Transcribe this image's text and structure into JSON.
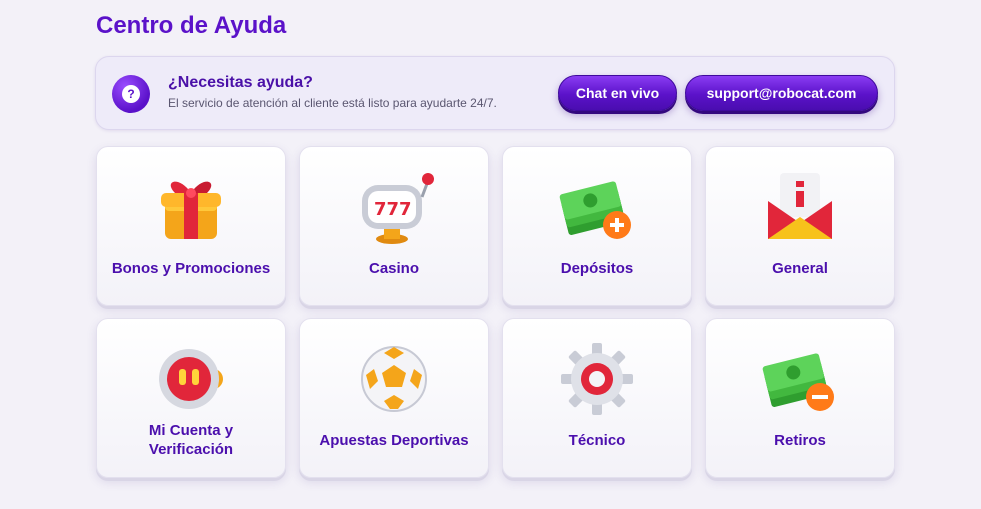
{
  "page": {
    "title": "Centro de Ayuda"
  },
  "help": {
    "title": "¿Necesitas ayuda?",
    "subtitle": "El servicio de atención al cliente está listo para ayudarte 24/7.",
    "icon": "question-icon",
    "chat_label": "Chat en vivo",
    "email_label": "support@robocat.com"
  },
  "categories": [
    {
      "label": "Bonos y Promociones",
      "icon": "gift-icon"
    },
    {
      "label": "Casino",
      "icon": "slot-machine-icon"
    },
    {
      "label": "Depósitos",
      "icon": "money-plus-icon"
    },
    {
      "label": "General",
      "icon": "info-envelope-icon"
    },
    {
      "label": "Mi Cuenta y Verificación",
      "icon": "robot-account-icon"
    },
    {
      "label": "Apuestas Deportivas",
      "icon": "soccer-ball-icon"
    },
    {
      "label": "Técnico",
      "icon": "gear-icon"
    },
    {
      "label": "Retiros",
      "icon": "money-minus-icon"
    }
  ],
  "colors": {
    "accent": "#5b12c9",
    "label": "#4b0fad",
    "background": "#f3f1f8"
  }
}
